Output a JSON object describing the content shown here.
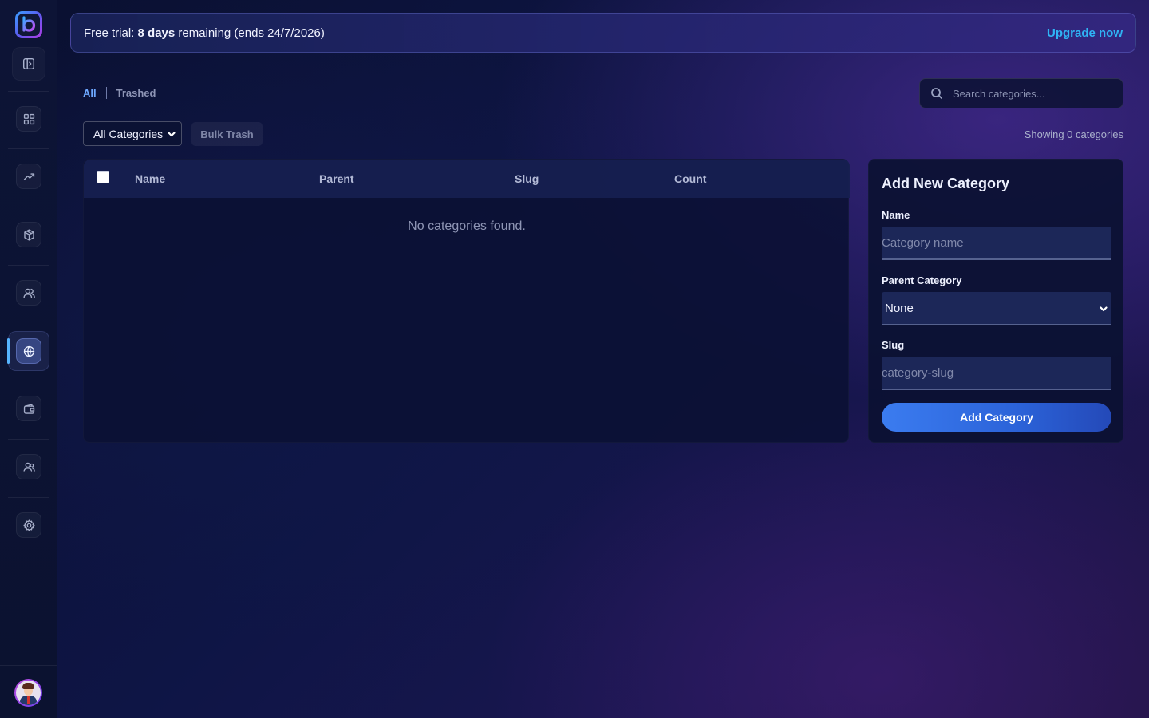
{
  "banner": {
    "prefix": "Free trial: ",
    "days": "8 days",
    "suffix": " remaining (ends 24/7/2026)",
    "upgrade_label": "Upgrade now"
  },
  "tabs": {
    "all": "All",
    "trashed": "Trashed"
  },
  "search": {
    "placeholder": "Search categories..."
  },
  "filters": {
    "category_select_value": "All Categories",
    "bulk_trash_label": "Bulk Trash",
    "showing_text": "Showing 0 categories"
  },
  "table": {
    "columns": [
      "Name",
      "Parent",
      "Slug",
      "Count"
    ],
    "empty_message": "No categories found."
  },
  "form": {
    "title": "Add New Category",
    "name_label": "Name",
    "name_placeholder": "Category name",
    "parent_label": "Parent Category",
    "parent_value": "None",
    "slug_label": "Slug",
    "slug_placeholder": "category-slug",
    "submit_label": "Add Category"
  },
  "sidebar": {
    "items": [
      {
        "icon": "dashboard-grid-icon"
      },
      {
        "icon": "trending-up-icon"
      },
      {
        "icon": "box-icon"
      },
      {
        "icon": "users-icon"
      },
      {
        "icon": "globe-icon",
        "active": true
      },
      {
        "icon": "wallet-icon"
      },
      {
        "icon": "team-icon"
      },
      {
        "icon": "gear-icon"
      }
    ]
  },
  "colors": {
    "accent": "#2fb4f5",
    "tab_active": "#6ea8ff",
    "button": "#3b7cf0"
  }
}
